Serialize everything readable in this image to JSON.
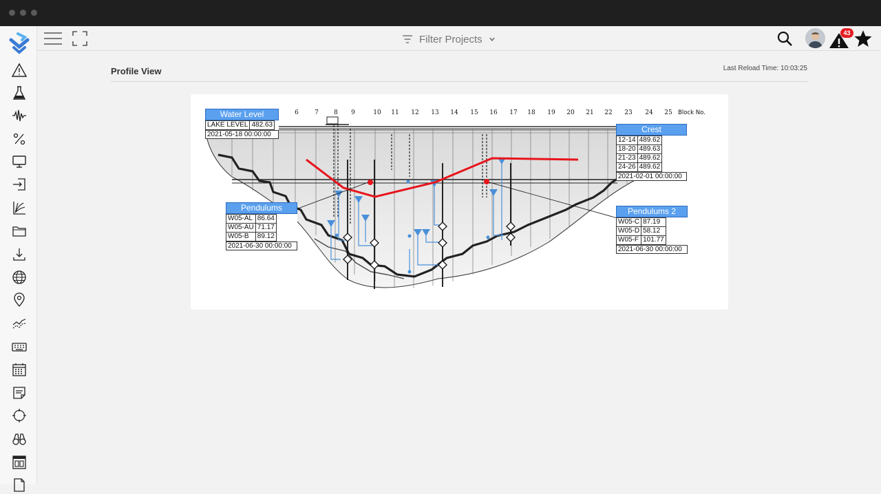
{
  "window": {
    "controls": [
      "window-dot-1",
      "window-dot-2",
      "window-dot-3"
    ]
  },
  "sidebar": {
    "logo": "app-logo-icon",
    "items": [
      {
        "icon": "warning-icon"
      },
      {
        "icon": "flask-icon"
      },
      {
        "icon": "seismic-wave-icon"
      },
      {
        "icon": "percent-icon"
      },
      {
        "icon": "monitor-icon"
      },
      {
        "icon": "import-icon"
      },
      {
        "icon": "growth-chart-icon"
      },
      {
        "icon": "folder-icon"
      },
      {
        "icon": "download-icon"
      },
      {
        "icon": "globe-icon"
      },
      {
        "icon": "location-pin-icon"
      },
      {
        "icon": "trend-lines-icon"
      },
      {
        "icon": "keyboard-icon"
      },
      {
        "icon": "calendar-icon"
      },
      {
        "icon": "note-icon"
      },
      {
        "icon": "crosshair-icon"
      },
      {
        "icon": "binoculars-icon"
      },
      {
        "icon": "layout-icon"
      },
      {
        "icon": "document-icon"
      }
    ]
  },
  "topbar": {
    "filter_label": "Filter Projects",
    "alert_count": "43"
  },
  "page": {
    "title": "Profile View",
    "last_reload": "Last Reload Time: 10:03:25"
  },
  "diagram": {
    "block_numbers": [
      "6",
      "7",
      "8",
      "9",
      "10",
      "11",
      "12",
      "13",
      "14",
      "15",
      "16",
      "17",
      "18",
      "19",
      "20",
      "21",
      "22",
      "23",
      "24",
      "25"
    ],
    "block_no_label": "Block No.",
    "water_level": {
      "title": "Water Level",
      "rows": [
        {
          "label": "LAKE LEVEL",
          "value": "482.63"
        }
      ],
      "timestamp": "2021-05-18 00:00:00"
    },
    "crest": {
      "title": "Crest",
      "rows": [
        {
          "label": "12-14",
          "value": "489.62"
        },
        {
          "label": "18-20",
          "value": "489.63"
        },
        {
          "label": "21-23",
          "value": "489.62"
        },
        {
          "label": "24-26",
          "value": "489.62"
        }
      ],
      "timestamp": "2021-02-01 00:00:00"
    },
    "pendulums": {
      "title": "Pendulums",
      "rows": [
        {
          "label": "W05-AL",
          "value": "86.64"
        },
        {
          "label": "W05-AU",
          "value": "71.17"
        },
        {
          "label": "W05-B",
          "value": "89.12"
        }
      ],
      "timestamp": "2021-06-30 00:00:00"
    },
    "pendulums2": {
      "title": "Pendulums 2",
      "rows": [
        {
          "label": "W05-C",
          "value": "87.19"
        },
        {
          "label": "W05-D",
          "value": "58.12"
        },
        {
          "label": "W05-F",
          "value": "101.77"
        }
      ],
      "timestamp": "2021-06-30 00:00:00"
    }
  },
  "colors": {
    "accent_blue": "#5aa0ee",
    "deflection_red": "#e8141c",
    "pendulum_blue": "#4a90d9",
    "badge_red": "#e51c23"
  }
}
